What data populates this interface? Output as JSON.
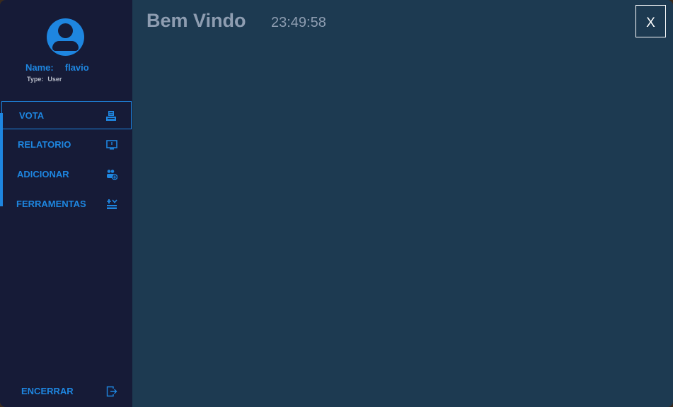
{
  "user": {
    "name_label": "Name:",
    "name_value": "flavio",
    "type_label": "Type:",
    "type_value": "User",
    "avatar_icon": "user-avatar-icon"
  },
  "sidebar": {
    "items": [
      {
        "label": "VOTA",
        "icon": "ballot-box-icon",
        "active": true
      },
      {
        "label": "RELATORIO",
        "icon": "monitor-icon",
        "active": false
      },
      {
        "label": "ADICIONAR",
        "icon": "add-users-icon",
        "active": false
      },
      {
        "label": "FERRAMENTAS",
        "icon": "tools-icon",
        "active": false
      }
    ],
    "logout": {
      "label": "ENCERRAR",
      "icon": "exit-icon"
    }
  },
  "header": {
    "title": "Bem Vindo",
    "clock": "23:49:58",
    "close_label": "X"
  },
  "colors": {
    "accent": "#1e86e0",
    "sidebar_bg": "#161b37",
    "main_bg": "#1d3a51",
    "title_text": "#8e9db1"
  }
}
